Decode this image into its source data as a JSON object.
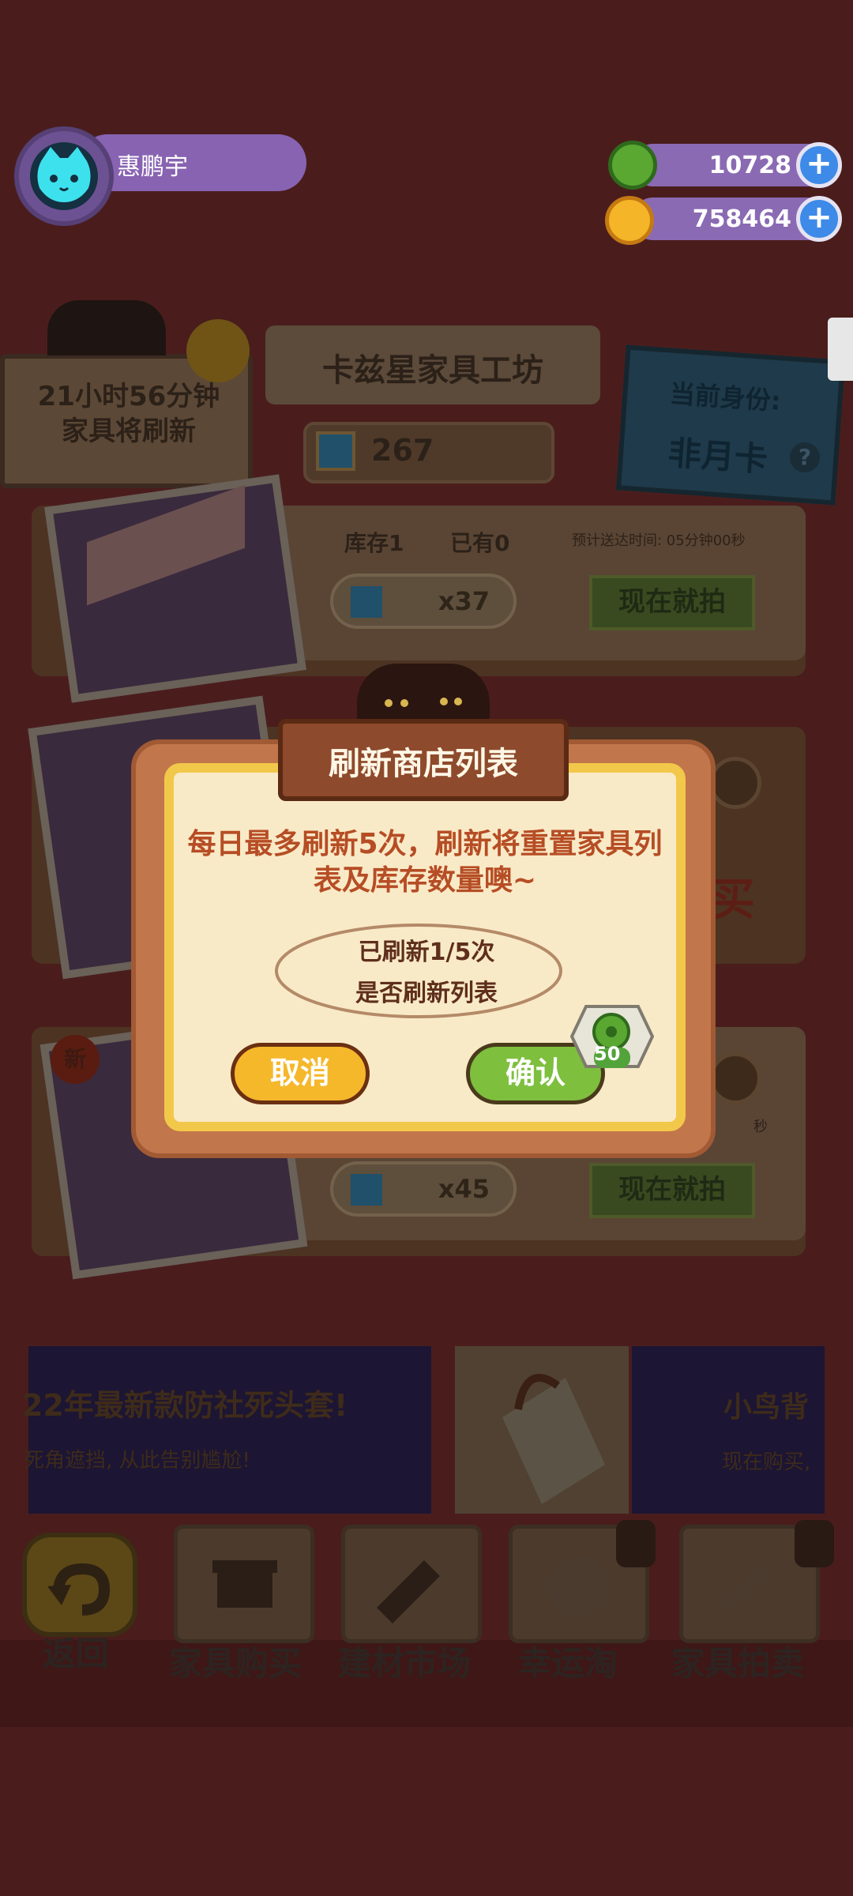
{
  "header": {
    "player_name": "惠鹏宇",
    "currency_green": "10728",
    "currency_gold": "758464"
  },
  "shop": {
    "timer_line1": "21小时56分钟",
    "timer_line2": "家具将刷新",
    "title": "卡兹星家具工坊",
    "ticket_count": "267",
    "identity_label": "当前身份:",
    "identity_value": "非月卡",
    "items": [
      {
        "stock": "库存1",
        "owned": "已有0",
        "delivery": "预计送达时间: 05分钟00秒",
        "price": "x37",
        "bid": "现在就拍"
      },
      {
        "stock": "",
        "owned": "",
        "delivery": "",
        "price": "",
        "bid": "买"
      },
      {
        "badge": "新",
        "delivery": "秒",
        "price": "x45",
        "bid": "现在就拍"
      }
    ]
  },
  "banners": {
    "left_title": "22年最新款防社死头套!",
    "left_sub": "死角遮挡, 从此告别尴尬!",
    "right_title": "小鸟背",
    "right_sub": "现在购买,"
  },
  "nav": {
    "back": "返回",
    "tab1": "家具购买",
    "tab2": "建材市场",
    "tab3": "幸运淘",
    "tab4": "家具拍卖"
  },
  "dialog": {
    "title": "刷新商店列表",
    "message": "每日最多刷新5次，刷新将重置家具列表及库存数量噢~",
    "status_line1": "已刷新1/5次",
    "status_line2": "是否刷新列表",
    "cancel_label": "取消",
    "confirm_label": "确认",
    "cost": "50"
  },
  "colors": {
    "background": "#4a1d1c",
    "dialog_frame": "#c2764b",
    "dialog_inner": "#f9eac7",
    "dialog_border": "#f2c84a",
    "cancel_button": "#f5b82b",
    "confirm_button": "#7ebf3e",
    "purple_pill": "#8763b1",
    "plus_button": "#3d8ae8"
  }
}
